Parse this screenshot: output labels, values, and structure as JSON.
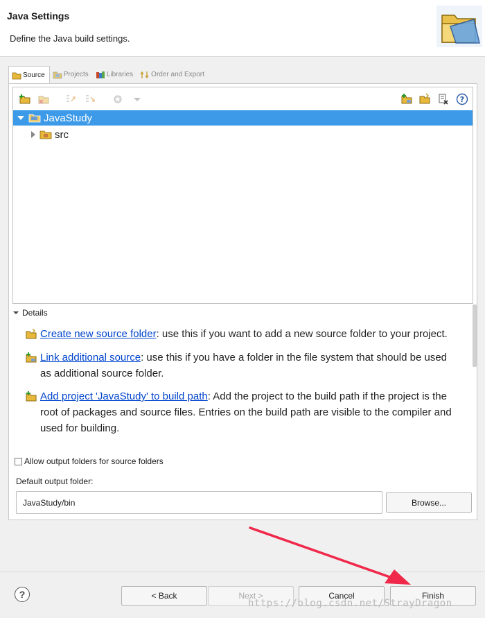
{
  "header": {
    "title": "Java Settings",
    "description": "Define the Java build settings."
  },
  "tabs": [
    {
      "label": "Source",
      "icon": "source-folder-icon",
      "active": true
    },
    {
      "label": "Projects",
      "icon": "projects-icon",
      "active": false
    },
    {
      "label": "Libraries",
      "icon": "libraries-icon",
      "active": false
    },
    {
      "label": "Order and Export",
      "icon": "order-export-icon",
      "active": false
    }
  ],
  "tree": {
    "project": "JavaStudy",
    "children": [
      "src"
    ]
  },
  "details": {
    "label": "Details",
    "items": [
      {
        "link": "Create new source folder",
        "text": ": use this if you want to add a new source folder to your project."
      },
      {
        "link": "Link additional source",
        "text": ": use this if you have a folder in the file system that should be used as additional source folder."
      },
      {
        "link": "Add project 'JavaStudy' to build path",
        "text": ": Add the project to the build path if the project is the root of packages and source files. Entries on the build path are visible to the compiler and used for building."
      }
    ]
  },
  "options": {
    "allow_output_folders": "Allow output folders for source folders",
    "output_folder_label": "Default output folder:",
    "output_folder_value": "JavaStudy/bin",
    "browse": "Browse..."
  },
  "footer": {
    "help": "?",
    "back": "< Back",
    "next": "Next >",
    "cancel": "Cancel",
    "finish": "Finish"
  },
  "watermark": "https://blog.csdn.net/StrayDragon",
  "colors": {
    "selection": "#3c9ae8",
    "link": "#0044cc",
    "annotation_arrow": "#f0284a"
  }
}
